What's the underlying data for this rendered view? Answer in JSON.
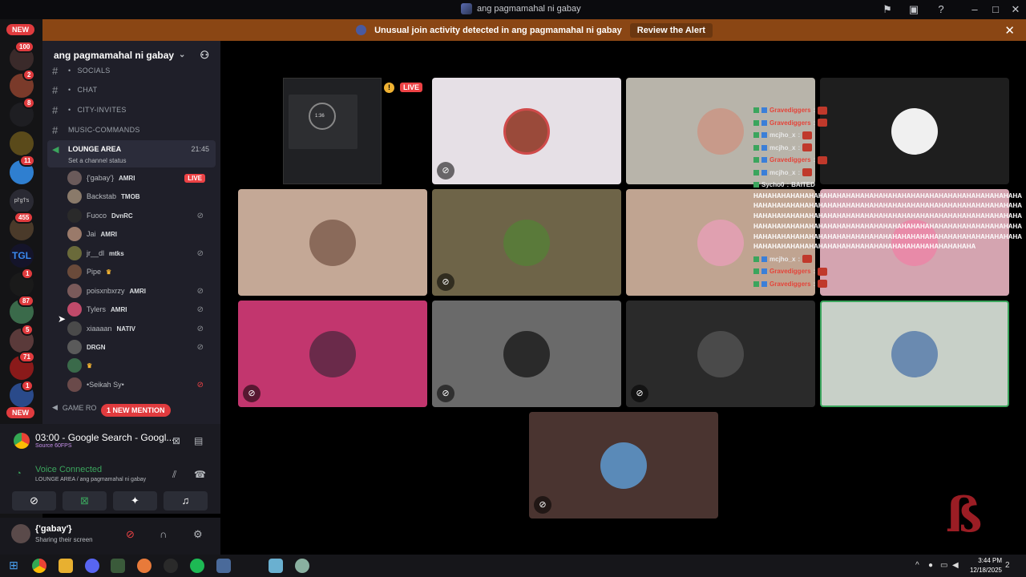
{
  "window": {
    "title": "ang pagmamahal ni gabay"
  },
  "alert": {
    "text": "Unusual join activity detected in ang pagmamahal ni gabay",
    "button": "Review the Alert"
  },
  "rail": {
    "new_top": "NEW",
    "new_bottom": "NEW",
    "badges": [
      "100",
      "2",
      "8",
      "11",
      "455",
      "1",
      "87",
      "5",
      "71",
      "1"
    ],
    "server_label": "pl'g'l's"
  },
  "server": {
    "name": "ang pagmamahal ni gabay"
  },
  "channels": [
    {
      "name": "SOCIALS",
      "prefix": "•"
    },
    {
      "name": "CHAT",
      "prefix": "•"
    },
    {
      "name": "CITY-INVITES",
      "prefix": "•"
    },
    {
      "name": "MUSIC-COMMANDS",
      "prefix": ""
    }
  ],
  "voice_channel": {
    "name": "LOUNGE AREA",
    "time": "21:45",
    "status": "Set a channel status"
  },
  "voice_users": [
    {
      "name": "{'gabay'}",
      "tag": "AMRI",
      "live": "LIVE"
    },
    {
      "name": "Backstab",
      "tag": "TMOB"
    },
    {
      "name": "Fuoco",
      "tag": "DvnRC"
    },
    {
      "name": "Jai",
      "tag": "AMRI"
    },
    {
      "name": "jr__dl",
      "tag": "mtks"
    },
    {
      "name": "Pipe",
      "tag": ""
    },
    {
      "name": "poisxnbxrzy",
      "tag": "AMRI"
    },
    {
      "name": "Tylers",
      "tag": "AMRI"
    },
    {
      "name": "xiaaaan",
      "tag": "NATIV"
    },
    {
      "name": "",
      "tag": "DRGN"
    },
    {
      "name": "",
      "tag": ""
    },
    {
      "name": "•Seikah Sy•",
      "tag": ""
    }
  ],
  "game_room": "GAME RO",
  "mention_pill": "1 NEW MENTION",
  "stream": {
    "title": "03:00 - Google Search - Googl...",
    "sub": "Source 60FPS"
  },
  "voice": {
    "status": "Voice Connected",
    "location": "LOUNGE AREA / ang pagmamahal ni gabay"
  },
  "user": {
    "name": "{'gabay'}",
    "status": "Sharing their screen"
  },
  "stage": {
    "live_label": "LIVE",
    "screen_timer": "1:36"
  },
  "chat_overlay": {
    "lines": [
      {
        "name": "Gravediggers",
        "red": true
      },
      {
        "name": "Gravediggers",
        "red": true
      },
      {
        "name": "mcjho_x",
        "red": false
      },
      {
        "name": "mcjho_x",
        "red": false
      },
      {
        "name": "Gravediggers",
        "red": true
      },
      {
        "name": "mcjho_x",
        "red": false
      }
    ],
    "sycho_name": "Sycho0",
    "sycho_msg": "BAITED",
    "spam": "HAHAHAHAHAHAHAHAHAHAHAHAHAHAHAHAHAHAHAHAHAHAHAHAHAHAHAHAHAHAHAHAHAHAHAHAHAHAHAHAHAHAHAHAHAHAHAHAHAHAHAHAHAHAHAHAHAHAHAHAHAHAHAHAHAHAHAHAHAHAHAHAHAHAHAHAHAHAHAHAHAHAHAHAHAHAHAHAHAHAHAHAHAHAHAHAHAHAHAHAHAHAHAHAHAHAHAHAHAHAHAHAHAHAHAHAHAHAHAHAHAHAHAHAHAHAHAHAHAHAHAHAHAHAHAHAHAHAHAHAHAHAHAHAHAHAHAHAHAHAHAHAHAHAHAHAHAHAHAHAHAHAHAHAHAHAHAHAHA",
    "after": [
      {
        "name": "mcjho_x",
        "red": false
      },
      {
        "name": "Gravediggers",
        "red": true
      },
      {
        "name": "Gravediggers",
        "red": true
      }
    ]
  },
  "taskbar": {
    "time": "3:44 PM",
    "date": "12/18/2025",
    "notif": "2"
  }
}
